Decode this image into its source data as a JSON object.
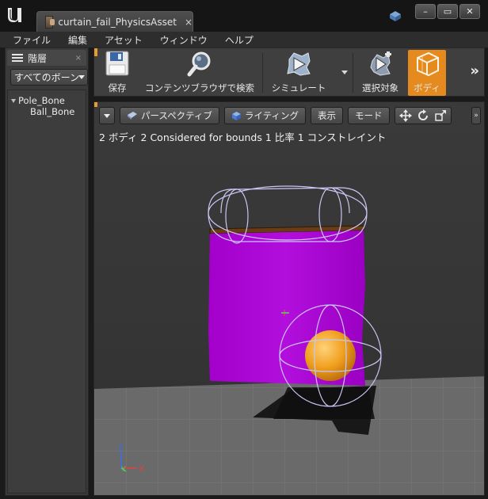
{
  "window": {
    "tab_title": "curtain_fail_PhysicsAsset",
    "tab_close": "×",
    "buttons": {
      "minimize": "–",
      "maximize": "▭",
      "close": "✕"
    }
  },
  "menubar": {
    "items": [
      "ファイル",
      "編集",
      "アセット",
      "ウィンドウ",
      "ヘルプ"
    ]
  },
  "hierarchy": {
    "tab_label": "階層",
    "tab_close": "×",
    "filter_value": "すべてのボーン",
    "bones": [
      {
        "label": "Pole_Bone",
        "level": 0
      },
      {
        "label": "Ball_Bone",
        "level": 1
      }
    ]
  },
  "toolbar": {
    "save": "保存",
    "browse": "コンテンツブラウザで検索",
    "simulate": "シミュレート",
    "select_target": "選択対象",
    "body": "ボディ",
    "overflow": "»"
  },
  "viewport": {
    "perspective": "パースペクティブ",
    "lighting": "ライティング",
    "show": "表示",
    "mode": "モード",
    "overflow": "»",
    "stats": "2 ボディ 2 Considered for bounds 1 比率 1 コンストレイント",
    "axes": {
      "x": "X",
      "y": "Y",
      "z": "Z"
    }
  },
  "colors": {
    "accent": "#e58a1f",
    "mesh": "#b000d8",
    "ball": "#f0a01e",
    "wireframe": "#c9c6f4",
    "floor": "#6e6e6e"
  },
  "icons": {
    "logo": "unreal-logo-icon",
    "save": "floppy-disk-icon",
    "browse": "magnifier-icon",
    "simulate": "simulate-play-icon",
    "select": "select-target-icon",
    "body": "body-box-icon"
  }
}
